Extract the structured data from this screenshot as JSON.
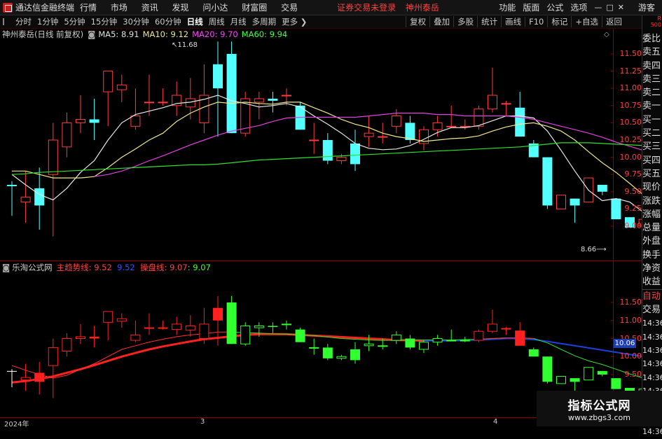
{
  "title_bar": {
    "app_name": "通达信金融终端",
    "menu": [
      "行情",
      "市场",
      "资讯",
      "发现",
      "问小达",
      "财富圈",
      "交易"
    ],
    "center_notice": "证券交易未登录",
    "center_stock": "神州泰岳",
    "right_menu": [
      "功能",
      "版面",
      "公式",
      "选项"
    ],
    "guest": "游客"
  },
  "toolbar": {
    "periods": [
      "分时",
      "1分钟",
      "5分钟",
      "15分钟",
      "30分钟",
      "60分钟",
      "日线",
      "周线",
      "月线",
      "多周期",
      "更多"
    ],
    "active_period": "日线",
    "right_tools": [
      "复权",
      "叠加",
      "多股",
      "统计",
      "画线",
      "F10",
      "标记",
      "+自选",
      "返回"
    ]
  },
  "main_chart": {
    "stock": "神州泰岳",
    "mode": "(日线 前复权)",
    "ma5_label": "MA5:",
    "ma5": "8.91",
    "ma10_label": "MA10:",
    "ma10": "9.12",
    "ma20_label": "MA20:",
    "ma20": "9.70",
    "ma60_label": "MA60:",
    "ma60": "9.94",
    "high_mark": "11.68",
    "low_mark": "8.66",
    "price_ticks": [
      "11.50",
      "11.25",
      "11.00",
      "10.75",
      "10.50",
      "10.25",
      "10.00",
      "9.75",
      "9.50",
      "9.25",
      "9.00"
    ]
  },
  "lower_chart": {
    "name": "乐淘公式网",
    "main_force_label": "主趋势线:",
    "main_force": "9.52",
    "blue_value": "9.52",
    "operate_label": "操盘线:",
    "operate": "9.07",
    "green_value": ": 9.07",
    "price_ticks": [
      "11.50",
      "11.00",
      "10.50",
      "10.00",
      "9.50"
    ],
    "current_value": "10.06"
  },
  "date_axis": [
    "2024年",
    "3",
    "4"
  ],
  "sidebar": {
    "top_indicator": [
      "R",
      "500"
    ],
    "items": [
      "委比",
      "卖五",
      "卖四",
      "卖三",
      "卖二",
      "卖一",
      "买一",
      "买二",
      "买三",
      "买四",
      "买五",
      "现价",
      "涨跌",
      "涨幅",
      "总量",
      "外盘",
      "换手",
      "净资",
      "收益"
    ],
    "auto_trade": [
      "自动",
      "交易"
    ],
    "times": [
      "14:36",
      "14:36",
      "14:36",
      "14:36",
      "14:36",
      "14:36",
      "14:36",
      "14:36",
      "14:36"
    ]
  },
  "watermark": {
    "line1": "指标公式网",
    "line2": "www.zbgs3.com"
  },
  "chart_data": [
    {
      "type": "candlestick",
      "title": "神州泰岳 (日线 前复权)",
      "ylim": [
        8.55,
        11.9
      ],
      "candles": [
        {
          "o": 9.6,
          "h": 9.65,
          "l": 9.15,
          "c": 9.58
        },
        {
          "o": 9.35,
          "h": 9.8,
          "l": 9.05,
          "c": 9.42
        },
        {
          "o": 9.55,
          "h": 9.85,
          "l": 8.95,
          "c": 9.3
        },
        {
          "o": 9.75,
          "h": 10.5,
          "l": 8.85,
          "c": 10.25
        },
        {
          "o": 10.15,
          "h": 10.65,
          "l": 10.0,
          "c": 10.5
        },
        {
          "o": 10.5,
          "h": 10.9,
          "l": 10.35,
          "c": 10.55
        },
        {
          "o": 10.55,
          "h": 10.85,
          "l": 10.25,
          "c": 10.5
        },
        {
          "o": 10.95,
          "h": 11.25,
          "l": 10.45,
          "c": 11.25
        },
        {
          "o": 10.98,
          "h": 11.2,
          "l": 10.8,
          "c": 11.05
        },
        {
          "o": 10.45,
          "h": 11.0,
          "l": 10.4,
          "c": 10.6
        },
        {
          "o": 10.8,
          "h": 11.2,
          "l": 10.6,
          "c": 10.8
        },
        {
          "o": 10.8,
          "h": 11.0,
          "l": 10.75,
          "c": 10.8
        },
        {
          "o": 10.75,
          "h": 11.1,
          "l": 10.6,
          "c": 10.9
        },
        {
          "o": 10.73,
          "h": 11.15,
          "l": 10.55,
          "c": 10.85
        },
        {
          "o": 10.5,
          "h": 11.35,
          "l": 10.35,
          "c": 10.9
        },
        {
          "o": 11.35,
          "h": 11.68,
          "l": 10.3,
          "c": 11.0
        },
        {
          "o": 11.5,
          "h": 11.68,
          "l": 10.35,
          "c": 10.35
        },
        {
          "o": 10.35,
          "h": 10.95,
          "l": 10.3,
          "c": 10.85
        },
        {
          "o": 10.8,
          "h": 10.95,
          "l": 10.55,
          "c": 10.85
        },
        {
          "o": 10.85,
          "h": 10.95,
          "l": 10.65,
          "c": 10.82
        },
        {
          "o": 10.9,
          "h": 11.0,
          "l": 10.75,
          "c": 10.9
        },
        {
          "o": 10.75,
          "h": 10.8,
          "l": 10.4,
          "c": 10.4
        },
        {
          "o": 10.25,
          "h": 10.5,
          "l": 10.05,
          "c": 10.25
        },
        {
          "o": 10.25,
          "h": 10.35,
          "l": 9.9,
          "c": 9.95
        },
        {
          "o": 9.95,
          "h": 10.05,
          "l": 9.9,
          "c": 10.0
        },
        {
          "o": 10.2,
          "h": 10.4,
          "l": 9.8,
          "c": 9.9
        },
        {
          "o": 10.3,
          "h": 10.6,
          "l": 10.15,
          "c": 10.35
        },
        {
          "o": 10.3,
          "h": 10.5,
          "l": 10.2,
          "c": 10.3
        },
        {
          "o": 10.45,
          "h": 10.7,
          "l": 10.35,
          "c": 10.6
        },
        {
          "o": 10.5,
          "h": 10.6,
          "l": 10.2,
          "c": 10.25
        },
        {
          "o": 10.2,
          "h": 10.45,
          "l": 10.1,
          "c": 10.4
        },
        {
          "o": 10.4,
          "h": 10.6,
          "l": 10.3,
          "c": 10.5
        },
        {
          "o": 10.45,
          "h": 10.75,
          "l": 10.45,
          "c": 10.45
        },
        {
          "o": 10.45,
          "h": 10.55,
          "l": 10.4,
          "c": 10.45
        },
        {
          "o": 10.45,
          "h": 10.75,
          "l": 10.4,
          "c": 10.7
        },
        {
          "o": 10.7,
          "h": 11.3,
          "l": 10.65,
          "c": 10.9
        },
        {
          "o": 10.78,
          "h": 10.82,
          "l": 10.6,
          "c": 10.78
        },
        {
          "o": 10.72,
          "h": 10.95,
          "l": 10.4,
          "c": 10.3
        },
        {
          "o": 10.2,
          "h": 10.25,
          "l": 10.0,
          "c": 10.0
        },
        {
          "o": 10.0,
          "h": 10.0,
          "l": 9.25,
          "c": 9.3
        },
        {
          "o": 9.25,
          "h": 9.45,
          "l": 9.25,
          "c": 9.45
        },
        {
          "o": 9.4,
          "h": 9.4,
          "l": 9.05,
          "c": 9.3
        },
        {
          "o": 9.35,
          "h": 9.7,
          "l": 9.35,
          "c": 9.7
        },
        {
          "o": 9.6,
          "h": 9.6,
          "l": 9.45,
          "c": 9.5
        },
        {
          "o": 9.4,
          "h": 9.4,
          "l": 9.1,
          "c": 9.1
        },
        {
          "o": 9.13,
          "h": 9.13,
          "l": 8.98,
          "c": 8.98
        },
        {
          "o": 9.0,
          "h": 9.13,
          "l": 9.0,
          "c": 9.1
        },
        {
          "o": 9.03,
          "h": 9.03,
          "l": 8.85,
          "c": 8.85
        },
        {
          "o": 8.9,
          "h": 8.95,
          "l": 8.85,
          "c": 8.93
        },
        {
          "o": 8.95,
          "h": 9.05,
          "l": 8.78,
          "c": 8.8
        },
        {
          "o": 8.88,
          "h": 8.92,
          "l": 8.85,
          "c": 8.88
        }
      ],
      "series": [
        {
          "name": "MA5",
          "values": [
            9.75,
            9.6,
            9.46,
            9.38,
            9.55,
            9.78,
            9.95,
            10.25,
            10.5,
            10.62,
            10.67,
            10.72,
            10.78,
            10.8,
            10.84,
            10.9,
            10.82,
            10.78,
            10.73,
            10.75,
            10.78,
            10.73,
            10.6,
            10.48,
            10.35,
            10.2,
            10.13,
            10.11,
            10.12,
            10.17,
            10.26,
            10.36,
            10.43,
            10.43,
            10.46,
            10.53,
            10.6,
            10.6,
            10.57,
            10.38,
            10.1,
            9.8,
            9.52,
            9.37,
            9.4,
            9.35,
            9.2,
            9.1,
            9.0,
            8.93,
            8.91
          ]
        },
        {
          "name": "MA10",
          "values": [
            9.8,
            9.8,
            9.75,
            9.7,
            9.7,
            9.7,
            9.72,
            9.85,
            10.0,
            10.12,
            10.25,
            10.35,
            10.52,
            10.64,
            10.73,
            10.8,
            10.78,
            10.8,
            10.78,
            10.77,
            10.8,
            10.8,
            10.72,
            10.64,
            10.55,
            10.48,
            10.43,
            10.35,
            10.3,
            10.27,
            10.23,
            10.25,
            10.27,
            10.28,
            10.31,
            10.38,
            10.44,
            10.48,
            10.5,
            10.45,
            10.38,
            10.25,
            10.08,
            9.92,
            9.78,
            9.62,
            9.45,
            9.32,
            9.23,
            9.16,
            9.12
          ]
        },
        {
          "name": "MA20",
          "values": [
            null,
            null,
            null,
            null,
            null,
            null,
            9.72,
            9.75,
            9.8,
            9.87,
            9.95,
            10.02,
            10.1,
            10.18,
            10.25,
            10.32,
            10.38,
            10.42,
            10.46,
            10.52,
            10.57,
            10.58,
            10.58,
            10.58,
            10.58,
            10.58,
            10.6,
            10.62,
            10.64,
            10.64,
            10.64,
            10.62,
            10.62,
            10.6,
            10.6,
            10.6,
            10.6,
            10.58,
            10.55,
            10.5,
            10.45,
            10.4,
            10.35,
            10.29,
            10.22,
            10.16,
            10.1,
            10.03,
            9.95,
            9.83,
            9.7
          ]
        },
        {
          "name": "MA60",
          "values": [
            9.75,
            9.76,
            9.78,
            9.79,
            9.8,
            9.81,
            9.82,
            9.83,
            9.84,
            9.85,
            9.86,
            9.87,
            9.88,
            9.89,
            9.89,
            9.9,
            9.92,
            9.94,
            9.96,
            9.97,
            9.98,
            9.99,
            10.0,
            10.01,
            10.02,
            10.03,
            10.04,
            10.05,
            10.06,
            10.07,
            10.08,
            10.09,
            10.1,
            10.11,
            10.12,
            10.13,
            10.14,
            10.15,
            10.17,
            10.19,
            10.21,
            10.21,
            10.21,
            10.2,
            10.19,
            10.18,
            10.17,
            10.17,
            10.17,
            10.17,
            10.17
          ]
        }
      ]
    },
    {
      "type": "candlestick",
      "title": "乐淘公式网",
      "ylim": [
        9.2,
        11.8
      ],
      "colors": {
        "up": "#ff2020",
        "down": "#30ff30",
        "neutral": "#ffffff"
      },
      "series": [
        {
          "name": "主趋势线",
          "values": [
            9.28,
            9.32,
            9.38,
            9.45,
            9.55,
            9.65,
            9.76,
            9.88,
            10.0,
            10.1,
            10.2,
            10.28,
            10.35,
            10.42,
            10.48,
            10.52,
            10.56,
            10.6,
            10.62,
            10.62,
            10.62,
            10.6,
            10.58,
            10.56,
            10.54,
            10.52,
            10.5,
            10.48,
            10.46,
            10.45,
            10.44,
            10.44,
            10.44,
            10.45,
            10.46,
            10.48,
            10.5,
            10.5,
            10.47,
            10.42,
            10.36,
            10.3,
            10.24,
            10.18,
            10.12,
            10.06,
            10.0,
            9.94,
            9.88,
            9.8,
            9.72
          ]
        },
        {
          "name": "操盘线",
          "values": [
            9.75,
            9.62,
            9.5,
            9.4,
            9.48,
            9.65,
            9.8,
            10.0,
            10.2,
            10.3,
            10.4,
            10.48,
            10.55,
            10.6,
            10.63,
            10.68,
            10.68,
            10.66,
            10.65,
            10.63,
            10.62,
            10.6,
            10.58,
            10.54,
            10.5,
            10.48,
            10.46,
            10.45,
            10.45,
            10.46,
            10.46,
            10.46,
            10.46,
            10.47,
            10.48,
            10.5,
            10.52,
            10.52,
            10.5,
            10.38,
            10.2,
            10.02,
            9.88,
            9.78,
            9.65,
            9.52,
            9.4,
            9.32,
            9.22,
            9.12,
            9.07
          ]
        }
      ]
    }
  ]
}
